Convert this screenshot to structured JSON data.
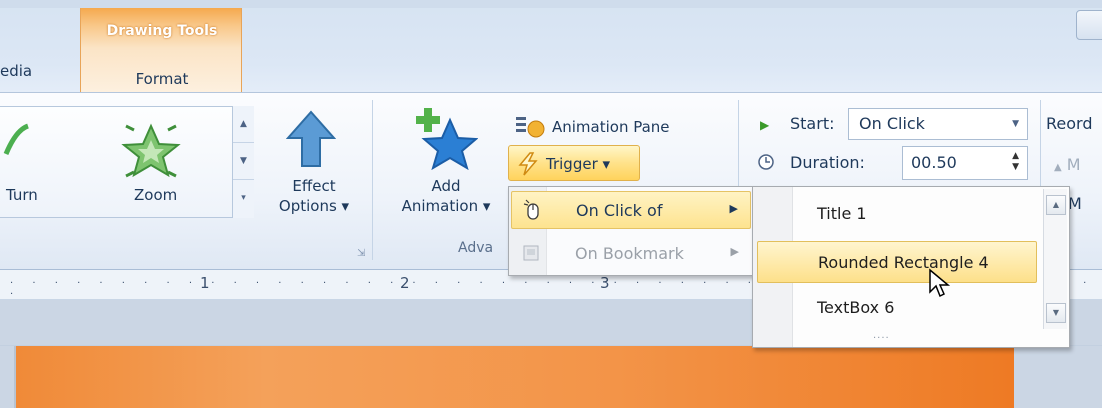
{
  "tabs": {
    "partial_tab": "edia",
    "context_group": "Drawing Tools",
    "context_tab": "Format"
  },
  "animation_gallery": {
    "items": [
      {
        "label": "Turn",
        "icon": "turn-animation-icon"
      },
      {
        "label": "Zoom",
        "icon": "zoom-animation-icon"
      }
    ]
  },
  "effect_options": {
    "line1": "Effect",
    "line2": "Options ▾"
  },
  "add_animation": {
    "line1": "Add",
    "line2": "Animation ▾"
  },
  "advanced_group_label": "Adva",
  "animation_pane_label": "Animation Pane",
  "trigger_label": "Trigger ▾",
  "timing": {
    "start_label": "Start:",
    "start_value": "On Click",
    "duration_label": "Duration:",
    "duration_value": "00.50"
  },
  "reorder": {
    "label": "Reord",
    "move_earlier": "M",
    "move_later": "M"
  },
  "ruler": {
    "marks": [
      "1",
      "2",
      "3"
    ]
  },
  "trigger_menu": {
    "items": [
      {
        "label": "On Click of",
        "highlighted": true,
        "enabled": true
      },
      {
        "label": "On Bookmark",
        "highlighted": false,
        "enabled": false
      }
    ]
  },
  "click_of_submenu": {
    "items": [
      {
        "label": "Title 1",
        "highlighted": false
      },
      {
        "label": "Rounded Rectangle 4",
        "highlighted": true
      },
      {
        "label": "TextBox 6",
        "highlighted": false
      }
    ]
  },
  "colors": {
    "context_tab": "#f5a94e",
    "highlight": "#fde38f",
    "slide": "#f08a38"
  }
}
